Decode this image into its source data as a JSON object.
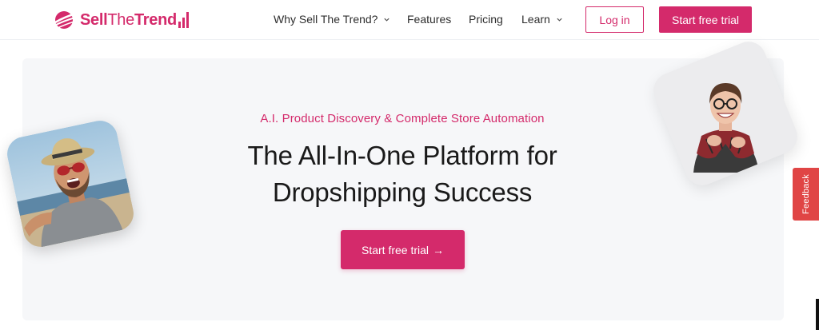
{
  "brand": {
    "name_part1": "Sell",
    "name_part2": "The",
    "name_part3": "Trend",
    "accent_color": "#d42a6b"
  },
  "nav": {
    "items": [
      {
        "label": "Why Sell The Trend?",
        "has_dropdown": true
      },
      {
        "label": "Features",
        "has_dropdown": false
      },
      {
        "label": "Pricing",
        "has_dropdown": false
      },
      {
        "label": "Learn",
        "has_dropdown": true
      }
    ],
    "login_label": "Log in",
    "trial_label": "Start free trial"
  },
  "hero": {
    "subtitle": "A.I. Product Discovery & Complete Store Automation",
    "headline_line1": "The All-In-One Platform for",
    "headline_line2": "Dropshipping Success",
    "cta_label": "Start free trial",
    "cta_arrow": "→"
  },
  "feedback_tab": {
    "label": "Feedback",
    "color": "#e04545"
  },
  "icons": {
    "logo": "sell-the-trend-logo-icon",
    "dropdown": "chevron-down-icon"
  }
}
